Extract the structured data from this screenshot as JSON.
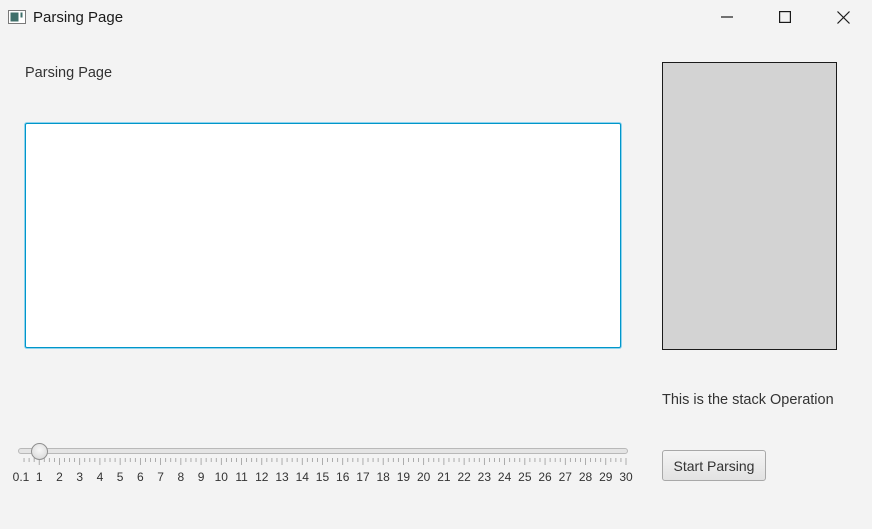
{
  "window": {
    "title": "Parsing Page",
    "controls": [
      "minimize-icon",
      "maximize-icon",
      "close-icon"
    ]
  },
  "main": {
    "page_label": "Parsing Page",
    "text_input_value": ""
  },
  "stack": {
    "label": "This is the stack Operation",
    "panel_color": "#d3d3d3"
  },
  "controls": {
    "start_button": "Start Parsing"
  },
  "slider": {
    "min": 0.1,
    "max": 30,
    "value": 1,
    "tick_labels": [
      "0.1",
      "1",
      "2",
      "3",
      "4",
      "5",
      "6",
      "7",
      "8",
      "9",
      "10",
      "11",
      "12",
      "13",
      "14",
      "15",
      "16",
      "17",
      "18",
      "19",
      "20",
      "21",
      "22",
      "23",
      "24",
      "25",
      "26",
      "27",
      "28",
      "29",
      "30"
    ]
  },
  "colors": {
    "accent": "#0096c9",
    "background": "#f3f3f3"
  }
}
